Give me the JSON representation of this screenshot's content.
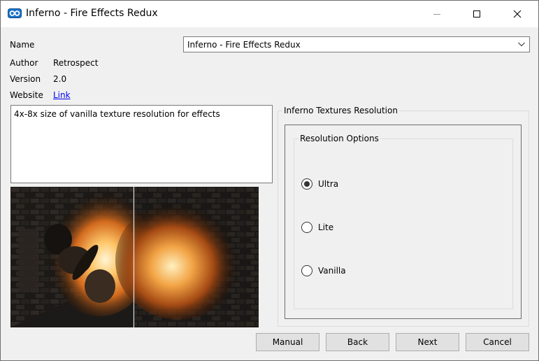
{
  "window": {
    "title": "Inferno - Fire Effects Redux"
  },
  "fields": {
    "name_label": "Name",
    "name_value": "Inferno - Fire Effects Redux",
    "author_label": "Author",
    "author_value": "Retrospect",
    "version_label": "Version",
    "version_value": "2.0",
    "website_label": "Website",
    "website_link": "Link"
  },
  "description": "4x-8x size of vanilla texture resolution for effects",
  "options_group": {
    "title": "Inferno Textures Resolution",
    "inner_title": "Resolution Options",
    "options": [
      {
        "label": "Ultra",
        "selected": true
      },
      {
        "label": "Lite",
        "selected": false
      },
      {
        "label": "Vanilla",
        "selected": false
      }
    ]
  },
  "buttons": {
    "manual": "Manual",
    "back": "Back",
    "next": "Next",
    "cancel": "Cancel"
  },
  "colors": {
    "link": "#0000ee",
    "window_bg": "#f0f0f0",
    "button_bg": "#e1e1e1"
  },
  "icons": {
    "app": "app-logo-icon",
    "minimize": "minimize-icon",
    "maximize": "maximize-icon",
    "close": "close-icon",
    "dropdown": "chevron-down-icon"
  }
}
